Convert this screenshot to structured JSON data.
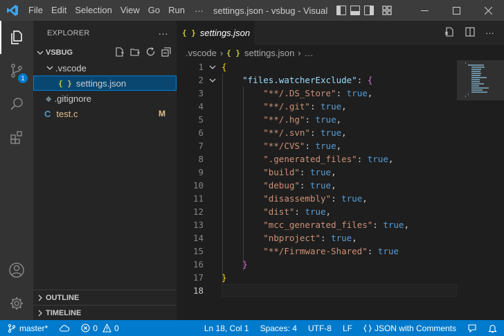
{
  "titlebar": {
    "menu": [
      "File",
      "Edit",
      "Selection",
      "View",
      "Go",
      "Run"
    ],
    "more": "···",
    "title": "settings.json - vsbug - Visual"
  },
  "activitybar": {
    "items": [
      "explorer-icon",
      "source-control-icon",
      "search-icon",
      "extensions-icon"
    ],
    "scm_badge": "1",
    "bottom": [
      "account-icon",
      "manage-gear-icon"
    ]
  },
  "sidebar": {
    "header": "EXPLORER",
    "header_more": "···",
    "folder": "VSBUG",
    "tree": [
      {
        "label": ".vscode",
        "kind": "folder"
      },
      {
        "label": "settings.json",
        "kind": "json"
      },
      {
        "label": ".gitignore",
        "kind": "git"
      },
      {
        "label": "test.c",
        "kind": "c",
        "badge": "M"
      }
    ],
    "outline": "OUTLINE",
    "timeline": "TIMELINE"
  },
  "editor": {
    "tab": {
      "label": "settings.json",
      "glyph": "{ }"
    },
    "breadcrumb": [
      ".vscode",
      "settings.json",
      "…"
    ],
    "breadcrumb_glyph": "{ }",
    "lines": [
      {
        "n": "1",
        "tokens": [
          [
            "t-brace1",
            "{"
          ]
        ],
        "fold": true
      },
      {
        "n": "2",
        "tokens": [
          [
            "t-punc",
            "    "
          ],
          [
            "t-key",
            "\"files.watcherExclude\""
          ],
          [
            "t-punc",
            ": "
          ],
          [
            "t-brace2",
            "{"
          ]
        ],
        "fold": true
      },
      {
        "n": "3",
        "tokens": [
          [
            "t-punc",
            "        "
          ],
          [
            "t-str",
            "\"**/.DS_Store\""
          ],
          [
            "t-punc",
            ": "
          ],
          [
            "t-kw",
            "true"
          ],
          [
            "t-punc",
            ","
          ]
        ]
      },
      {
        "n": "4",
        "tokens": [
          [
            "t-punc",
            "        "
          ],
          [
            "t-str",
            "\"**/.git\""
          ],
          [
            "t-punc",
            ": "
          ],
          [
            "t-kw",
            "true"
          ],
          [
            "t-punc",
            ","
          ]
        ]
      },
      {
        "n": "5",
        "tokens": [
          [
            "t-punc",
            "        "
          ],
          [
            "t-str",
            "\"**/.hg\""
          ],
          [
            "t-punc",
            ": "
          ],
          [
            "t-kw",
            "true"
          ],
          [
            "t-punc",
            ","
          ]
        ]
      },
      {
        "n": "6",
        "tokens": [
          [
            "t-punc",
            "        "
          ],
          [
            "t-str",
            "\"**/.svn\""
          ],
          [
            "t-punc",
            ": "
          ],
          [
            "t-kw",
            "true"
          ],
          [
            "t-punc",
            ","
          ]
        ]
      },
      {
        "n": "7",
        "tokens": [
          [
            "t-punc",
            "        "
          ],
          [
            "t-str",
            "\"**/CVS\""
          ],
          [
            "t-punc",
            ": "
          ],
          [
            "t-kw",
            "true"
          ],
          [
            "t-punc",
            ","
          ]
        ]
      },
      {
        "n": "8",
        "tokens": [
          [
            "t-punc",
            "        "
          ],
          [
            "t-str",
            "\".generated_files\""
          ],
          [
            "t-punc",
            ": "
          ],
          [
            "t-kw",
            "true"
          ],
          [
            "t-punc",
            ","
          ]
        ]
      },
      {
        "n": "9",
        "tokens": [
          [
            "t-punc",
            "        "
          ],
          [
            "t-str",
            "\"build\""
          ],
          [
            "t-punc",
            ": "
          ],
          [
            "t-kw",
            "true"
          ],
          [
            "t-punc",
            ","
          ]
        ]
      },
      {
        "n": "10",
        "tokens": [
          [
            "t-punc",
            "        "
          ],
          [
            "t-str",
            "\"debug\""
          ],
          [
            "t-punc",
            ": "
          ],
          [
            "t-kw",
            "true"
          ],
          [
            "t-punc",
            ","
          ]
        ]
      },
      {
        "n": "11",
        "tokens": [
          [
            "t-punc",
            "        "
          ],
          [
            "t-str",
            "\"disassembly\""
          ],
          [
            "t-punc",
            ": "
          ],
          [
            "t-kw",
            "true"
          ],
          [
            "t-punc",
            ","
          ]
        ]
      },
      {
        "n": "12",
        "tokens": [
          [
            "t-punc",
            "        "
          ],
          [
            "t-str",
            "\"dist\""
          ],
          [
            "t-punc",
            ": "
          ],
          [
            "t-kw",
            "true"
          ],
          [
            "t-punc",
            ","
          ]
        ]
      },
      {
        "n": "13",
        "tokens": [
          [
            "t-punc",
            "        "
          ],
          [
            "t-str",
            "\"mcc_generated_files\""
          ],
          [
            "t-punc",
            ": "
          ],
          [
            "t-kw",
            "true"
          ],
          [
            "t-punc",
            ","
          ]
        ]
      },
      {
        "n": "14",
        "tokens": [
          [
            "t-punc",
            "        "
          ],
          [
            "t-str",
            "\"nbproject\""
          ],
          [
            "t-punc",
            ": "
          ],
          [
            "t-kw",
            "true"
          ],
          [
            "t-punc",
            ","
          ]
        ]
      },
      {
        "n": "15",
        "tokens": [
          [
            "t-punc",
            "        "
          ],
          [
            "t-str",
            "\"**/Firmware-Shared\""
          ],
          [
            "t-punc",
            ": "
          ],
          [
            "t-kw",
            "true"
          ]
        ]
      },
      {
        "n": "16",
        "tokens": [
          [
            "t-punc",
            "    "
          ],
          [
            "t-brace2",
            "}"
          ]
        ]
      },
      {
        "n": "17",
        "tokens": [
          [
            "t-brace1",
            "}"
          ]
        ]
      },
      {
        "n": "18",
        "tokens": [],
        "current": true
      }
    ]
  },
  "statusbar": {
    "branch": "master*",
    "errors": "0",
    "warnings": "0",
    "position": "Ln 18, Col 1",
    "spaces": "Spaces: 4",
    "encoding": "UTF-8",
    "eol": "LF",
    "language": "JSON with Comments"
  },
  "colors": {
    "accent": "#007acc",
    "selection": "#094771",
    "modified": "#e2c08d"
  }
}
